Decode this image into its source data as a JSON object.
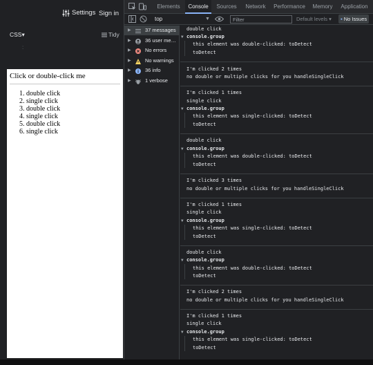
{
  "editor": {
    "settings_label": "Settings",
    "signin_label": "Sign in",
    "css_label": "CSS",
    "tidy_label": "Tidy",
    "colon": ":",
    "preview_title": "Click or double-click me",
    "preview_items": [
      "double click",
      "single click",
      "double click",
      "single click",
      "double click",
      "single click"
    ]
  },
  "devtools": {
    "tabs": [
      "Elements",
      "Console",
      "Sources",
      "Network",
      "Performance",
      "Memory",
      "Application"
    ],
    "active_tab": "Console",
    "context": "top",
    "filter_placeholder": "Filter",
    "levels_label": "Default levels",
    "issues_label": "No Issues",
    "sidebar": [
      {
        "label": "37 messages",
        "icon": "list-icon"
      },
      {
        "label": "36 user me…",
        "icon": "user-icon"
      },
      {
        "label": "No errors",
        "icon": "error-icon"
      },
      {
        "label": "No warnings",
        "icon": "warning-icon"
      },
      {
        "label": "36 info",
        "icon": "info-icon"
      },
      {
        "label": "1 verbose",
        "icon": "bug-icon"
      }
    ],
    "console_lines": [
      {
        "text": "double click",
        "kind": "plain"
      },
      {
        "text": "console.group",
        "kind": "group"
      },
      {
        "text": "this element was double-clicked: toDetect",
        "kind": "grouped"
      },
      {
        "text": "toDetect",
        "kind": "grouped"
      },
      {
        "text": "I'm clicked 2 times",
        "kind": "plain"
      },
      {
        "text": "no double or multiple clicks for you handleSingleClick",
        "kind": "plain"
      },
      {
        "text": "I'm clicked 1 times",
        "kind": "plain"
      },
      {
        "text": "single click",
        "kind": "plain"
      },
      {
        "text": "console.group",
        "kind": "group"
      },
      {
        "text": "this element was single-clicked: toDetect",
        "kind": "grouped"
      },
      {
        "text": "toDetect",
        "kind": "grouped"
      },
      {
        "text": "double click",
        "kind": "plain"
      },
      {
        "text": "console.group",
        "kind": "group"
      },
      {
        "text": "this element was double-clicked: toDetect",
        "kind": "grouped"
      },
      {
        "text": "toDetect",
        "kind": "grouped"
      },
      {
        "text": "I'm clicked 3 times",
        "kind": "plain"
      },
      {
        "text": "no double or multiple clicks for you handleSingleClick",
        "kind": "plain"
      },
      {
        "text": "I'm clicked 1 times",
        "kind": "plain"
      },
      {
        "text": "single click",
        "kind": "plain"
      },
      {
        "text": "console.group",
        "kind": "group"
      },
      {
        "text": "this element was single-clicked: toDetect",
        "kind": "grouped"
      },
      {
        "text": "toDetect",
        "kind": "grouped"
      },
      {
        "text": "double click",
        "kind": "plain"
      },
      {
        "text": "console.group",
        "kind": "group"
      },
      {
        "text": "this element was double-clicked: toDetect",
        "kind": "grouped"
      },
      {
        "text": "toDetect",
        "kind": "grouped"
      },
      {
        "text": "I'm clicked 2 times",
        "kind": "plain"
      },
      {
        "text": "no double or multiple clicks for you handleSingleClick",
        "kind": "plain"
      },
      {
        "text": "I'm clicked 1 times",
        "kind": "plain"
      },
      {
        "text": "single click",
        "kind": "plain"
      },
      {
        "text": "console.group",
        "kind": "group"
      },
      {
        "text": "this element was single-clicked: toDetect",
        "kind": "grouped"
      },
      {
        "text": "toDetect",
        "kind": "grouped"
      }
    ]
  },
  "colors": {
    "accent": "#8ab4f8",
    "error": "#f28b82",
    "warning": "#fdd663",
    "info": "#8ab4f8"
  }
}
